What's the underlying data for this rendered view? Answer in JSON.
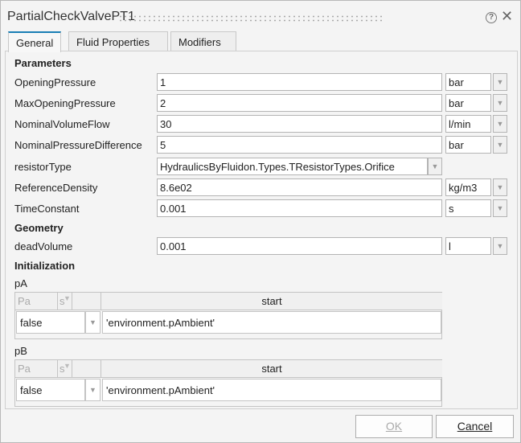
{
  "window": {
    "title": "PartialCheckValvePT1",
    "help_icon": "?",
    "close_icon": "✕"
  },
  "tabs": [
    {
      "label": "General"
    },
    {
      "label": "Fluid Properties"
    },
    {
      "label": "Modifiers"
    }
  ],
  "sections": {
    "parameters": "Parameters",
    "geometry": "Geometry",
    "initialization": "Initialization"
  },
  "params": [
    {
      "label": "OpeningPressure",
      "value": "1",
      "unit": "bar"
    },
    {
      "label": "MaxOpeningPressure",
      "value": "2",
      "unit": "bar"
    },
    {
      "label": "NominalVolumeFlow",
      "value": "30",
      "unit": "l/min"
    },
    {
      "label": "NominalPressureDifference",
      "value": "5",
      "unit": "bar"
    },
    {
      "label": "resistorType",
      "value": "HydraulicsByFluidon.Types.TResistorTypes.Orifice"
    },
    {
      "label": "ReferenceDensity",
      "value": "8.6e02",
      "unit": "kg/m3"
    },
    {
      "label": "TimeConstant",
      "value": "0.001",
      "unit": "s"
    }
  ],
  "geometry": [
    {
      "label": "deadVolume",
      "value": "0.001",
      "unit": "l"
    }
  ],
  "init": [
    {
      "label": "pA",
      "col1": "Pa",
      "col1b": "s",
      "col_start": "start",
      "fixed": "false",
      "start": "'environment.pAmbient'"
    },
    {
      "label": "pB",
      "col1": "Pa",
      "col1b": "s",
      "col_start": "start",
      "fixed": "false",
      "start": "'environment.pAmbient'"
    }
  ],
  "buttons": {
    "ok": "OK",
    "cancel": "Cancel"
  }
}
